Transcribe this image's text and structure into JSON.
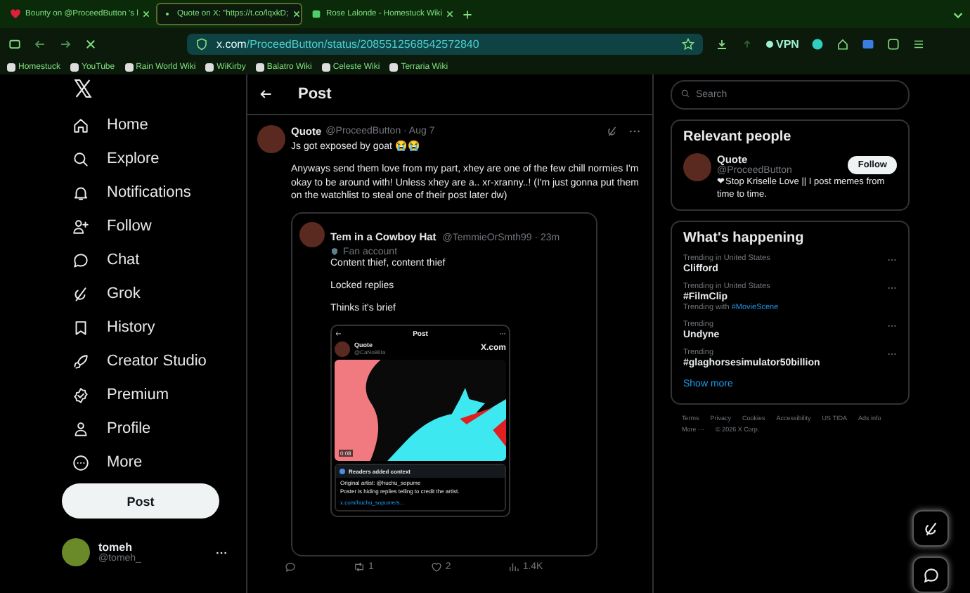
{
  "browser": {
    "tabs": [
      {
        "title": "Bounty on @ProceedButton 's l",
        "selected": false
      },
      {
        "title": "Quote on X: \"https://t.co/lqxkD;",
        "selected": true
      },
      {
        "title": "Rose Lalonde - Homestuck Wiki",
        "selected": false
      }
    ],
    "address": {
      "host": "x.com",
      "path": "/ProceedButton/status/2085512568542572840"
    },
    "vpn": "VPN",
    "bookmarks": [
      "Homestuck",
      "YouTube",
      "Rain World Wiki",
      "WiKirby",
      "Balatro Wiki",
      "Celeste Wiki",
      "Terraria Wiki"
    ]
  },
  "nav": {
    "items": [
      "Home",
      "Explore",
      "Notifications",
      "Follow",
      "Chat",
      "Grok",
      "History",
      "Creator Studio",
      "Premium",
      "Profile",
      "More"
    ],
    "post_button": "Post",
    "account": {
      "name": "tomeh",
      "handle": "@tomeh_"
    }
  },
  "main": {
    "title": "Post",
    "post": {
      "name": "Quote",
      "handle": "@ProceedButton",
      "date": "· Aug 7",
      "paragraphs": [
        "Js got exposed by goat 😭😭",
        "Anyways send them love from my part, xhey are one of the few chill normies I'm okay to be around with! Unless xhey are a.. xr-xranny..! (I'm just gonna put them on the watchlist to steal one of their post later dw)"
      ],
      "quote": {
        "name": "Tem in a Cowboy Hat",
        "handle": "@TemmieOrSmth99 · 23m",
        "badge": "Fan account",
        "paragraphs": [
          "Content thief, content thief",
          "Locked replies",
          "Thinks it's brief"
        ],
        "shot": {
          "title": "Post",
          "name": "Quote",
          "handle": "@CaNo96ta",
          "site": "X.com",
          "duration": "0:08",
          "context_title": "Readers added context",
          "context_lines": [
            "Original artist: @huchu_sopume",
            "Poster is hiding replies telling to credit the artist."
          ],
          "link": "x.com/huchu_sopume/s..."
        }
      },
      "actions": [
        {
          "kind": "reply"
        },
        {
          "kind": "repost",
          "count": "1"
        },
        {
          "kind": "like",
          "count": "2"
        },
        {
          "kind": "views",
          "count": "1.4K"
        }
      ]
    }
  },
  "side": {
    "search": {
      "placeholder": "Search"
    },
    "people": {
      "title": "Relevant people",
      "name": "Quote",
      "handle": "@ProceedButton",
      "bio": "❤Stop Kriselle Love || I post memes from time to time.",
      "button": "Follow"
    },
    "happening": {
      "title": "What's happening",
      "trends": [
        {
          "context": "Trending in United States",
          "name": "Clifford"
        },
        {
          "context": "Trending in United States",
          "name": "#FilmClip",
          "with_label": "Trending with",
          "with_tag": "#MovieScene"
        },
        {
          "context": "Trending",
          "name": "Undyne"
        },
        {
          "context": "Trending",
          "name": "#glaghorsesimulator50billion"
        }
      ],
      "show_more": "Show more"
    },
    "footer": [
      "Terms",
      "Privacy",
      "Cookies",
      "Accessibility",
      "US TIDA",
      "Ads info",
      "More ···",
      "© 2026 X Corp."
    ]
  }
}
